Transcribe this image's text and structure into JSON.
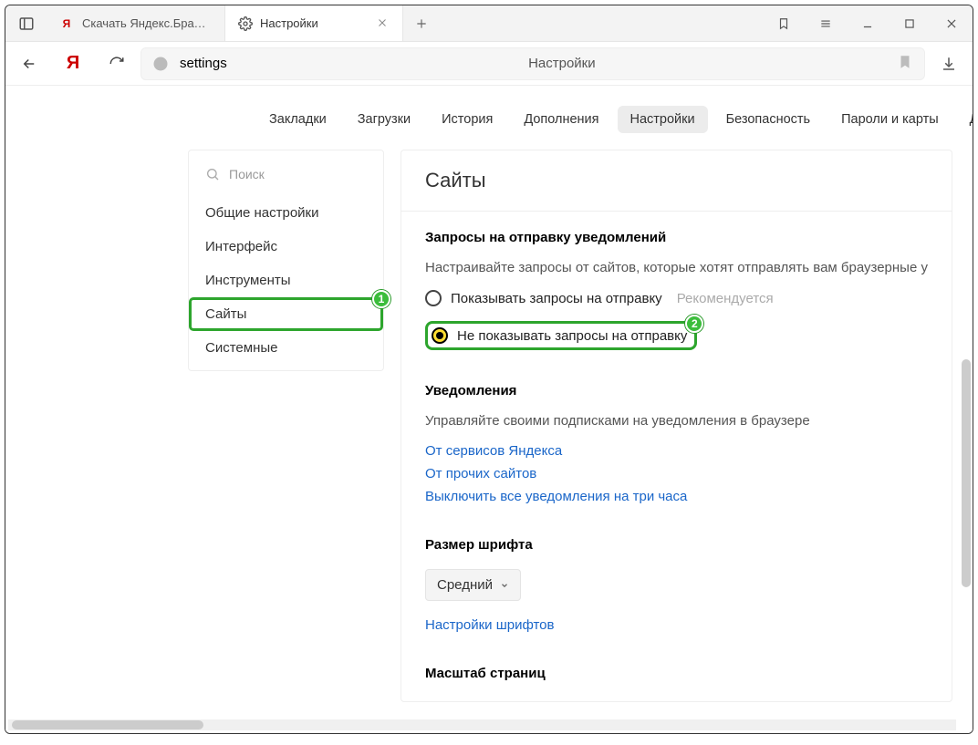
{
  "tabs": [
    {
      "label": "Скачать Яндекс.Браузер д"
    },
    {
      "label": "Настройки"
    }
  ],
  "omnibox": {
    "url": "settings",
    "title": "Настройки"
  },
  "topnav": {
    "items": [
      "Закладки",
      "Загрузки",
      "История",
      "Дополнения",
      "Настройки",
      "Безопасность",
      "Пароли и карты",
      "Другие устро"
    ],
    "active_index": 4
  },
  "sidebar": {
    "search_placeholder": "Поиск",
    "items": [
      "Общие настройки",
      "Интерфейс",
      "Инструменты",
      "Сайты",
      "Системные"
    ],
    "active_index": 3
  },
  "badges": {
    "sidebar": "1",
    "radio": "2"
  },
  "main": {
    "title": "Сайты",
    "notif_requests": {
      "heading": "Запросы на отправку уведомлений",
      "desc": "Настраивайте запросы от сайтов, которые хотят отправлять вам браузерные уве",
      "options": [
        {
          "label": "Показывать запросы на отправку",
          "hint": "Рекомендуется"
        },
        {
          "label": "Не показывать запросы на отправку"
        }
      ],
      "selected_index": 1
    },
    "notifications": {
      "heading": "Уведомления",
      "desc": "Управляйте своими подписками на уведомления в браузере",
      "links": [
        "От сервисов Яндекса",
        "От прочих сайтов",
        "Выключить все уведомления на три часа"
      ]
    },
    "font_size": {
      "heading": "Размер шрифта",
      "selected": "Средний",
      "link": "Настройки шрифтов"
    },
    "page_scale": {
      "heading": "Масштаб страниц"
    }
  }
}
